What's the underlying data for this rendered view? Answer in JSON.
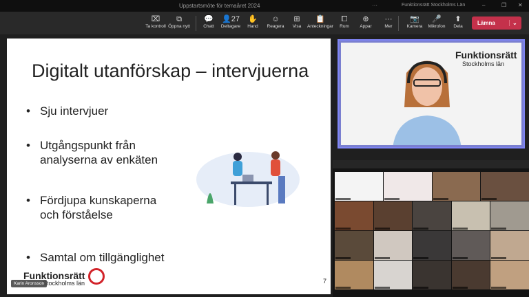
{
  "window": {
    "title": "Uppstartsmöte för temaåret 2024",
    "org": "Funktionsrätt Stockholms Län",
    "more": "···",
    "minimize": "–",
    "restore": "❐",
    "close": "✕"
  },
  "toolbar": {
    "items": [
      {
        "label": "Ta kontroll",
        "icon": "⌧"
      },
      {
        "label": "Öppna nytt",
        "icon": "⧉"
      },
      {
        "label": "Chatt",
        "icon": "💬"
      },
      {
        "label": "Deltagare",
        "icon": "👤27"
      },
      {
        "label": "Hand",
        "icon": "✋"
      },
      {
        "label": "Reagera",
        "icon": "☺"
      },
      {
        "label": "Visa",
        "icon": "⊞"
      },
      {
        "label": "Anteckningar",
        "icon": "📋"
      },
      {
        "label": "Rum",
        "icon": "⧠"
      },
      {
        "label": "Appar",
        "icon": "⊕"
      },
      {
        "label": "Mer",
        "icon": "···"
      },
      {
        "label": "Kamera",
        "icon": "📷"
      },
      {
        "label": "Mikrofon",
        "icon": "🎤"
      },
      {
        "label": "Dela",
        "icon": "⬆"
      }
    ],
    "participants_count": "27",
    "leave": "Lämna",
    "leave_color": "#c4314b"
  },
  "slide": {
    "title": "Digitalt utanförskap – intervjuerna",
    "bullets": [
      [
        "Sju intervjuer"
      ],
      [
        "Utgångspunkt från",
        "analyserna av enkäten"
      ],
      [
        "Fördjupa kunskaperna",
        "och förståelse"
      ],
      [
        "Samtal om tillgänglighet"
      ]
    ],
    "logo": "Funktionsrätt",
    "logo_sub": "Stockholms län",
    "page": "7",
    "presenter": "Karin Aronsson"
  },
  "speaker": {
    "logo": "Funktionsrätt",
    "logo_sub": "Stockholms län",
    "border_color": "#7f85f5"
  }
}
